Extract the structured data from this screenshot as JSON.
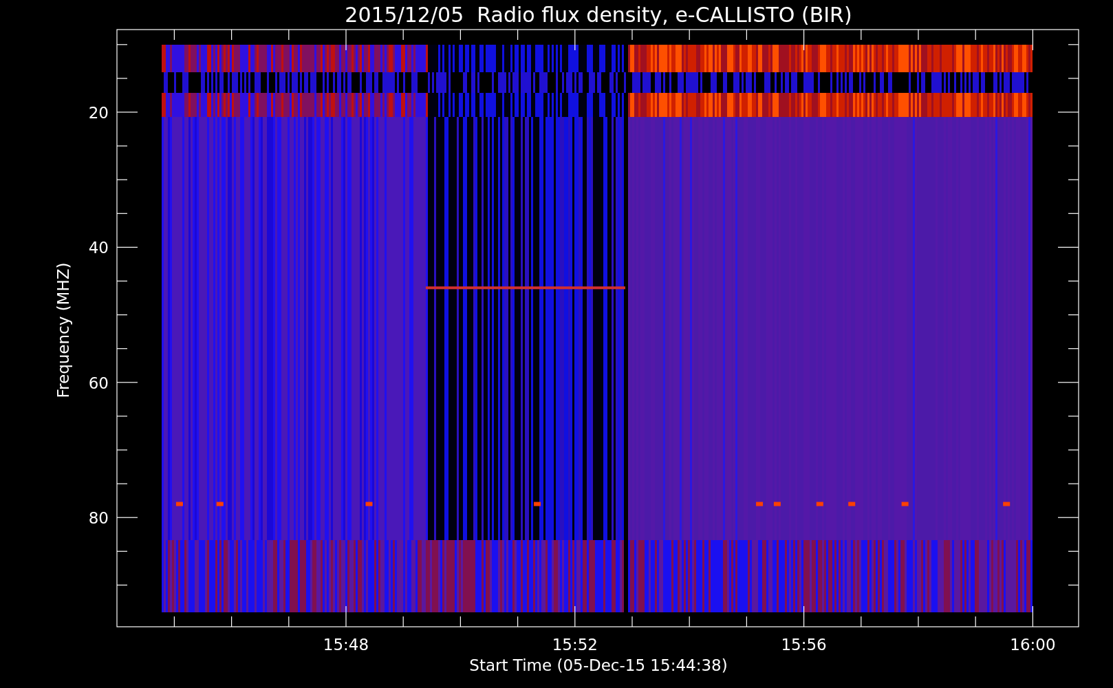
{
  "plot": {
    "title": "2015/12/05  Radio flux density, e-CALLISTO (BIR)",
    "xlabel": "Start Time (05-Dec-15 15:44:38)",
    "ylabel": "Frequency (MHZ)",
    "y_ticks": [
      "20",
      "40",
      "60",
      "80"
    ],
    "x_ticks": [
      "15:48",
      "15:52",
      "15:56",
      "16:00"
    ]
  }
}
